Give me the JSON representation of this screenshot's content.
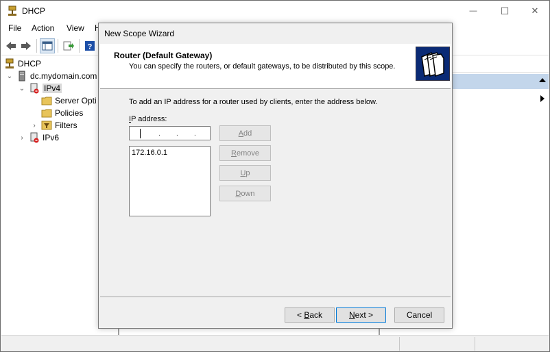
{
  "window": {
    "title": "DHCP",
    "controls": {
      "minimize": "—",
      "maximize": "☐",
      "close": "✕"
    }
  },
  "menubar": {
    "items": [
      "File",
      "Action",
      "View",
      "H"
    ]
  },
  "toolbar": {
    "icons": [
      "back-arrow-icon",
      "forward-arrow-icon",
      "console-tree-icon",
      "export-list-icon",
      "help-icon"
    ]
  },
  "tree": {
    "root": "DHCP",
    "server": "dc.mydomain.com",
    "ipv4": "IPv4",
    "server_options": "Server Opti",
    "policies": "Policies",
    "filters": "Filters",
    "ipv6": "IPv6"
  },
  "wizard": {
    "title": "New Scope Wizard",
    "header_title": "Router (Default Gateway)",
    "header_subtitle": "You can specify the routers, or default gateways, to be distributed by this scope.",
    "description": "To add an IP address for a router used by clients, enter the address below.",
    "ip_label_underlined": "I",
    "ip_label_rest": "P address:",
    "ip_list": [
      "172.16.0.1"
    ],
    "buttons": {
      "add_u": "A",
      "add_rest": "dd",
      "remove_u": "R",
      "remove_rest": "emove",
      "up_u": "U",
      "up_rest": "p",
      "down_u": "D",
      "down_rest": "own"
    },
    "footer": {
      "back_prefix": "< ",
      "back_u": "B",
      "back_rest": "ack",
      "next_u": "N",
      "next_rest": "ext >",
      "cancel": "Cancel"
    }
  },
  "colors": {
    "selection_blue": "#c3d6eb",
    "wizard_bg": "#f0f0f0",
    "header_image_bg": "#0a2a75"
  }
}
